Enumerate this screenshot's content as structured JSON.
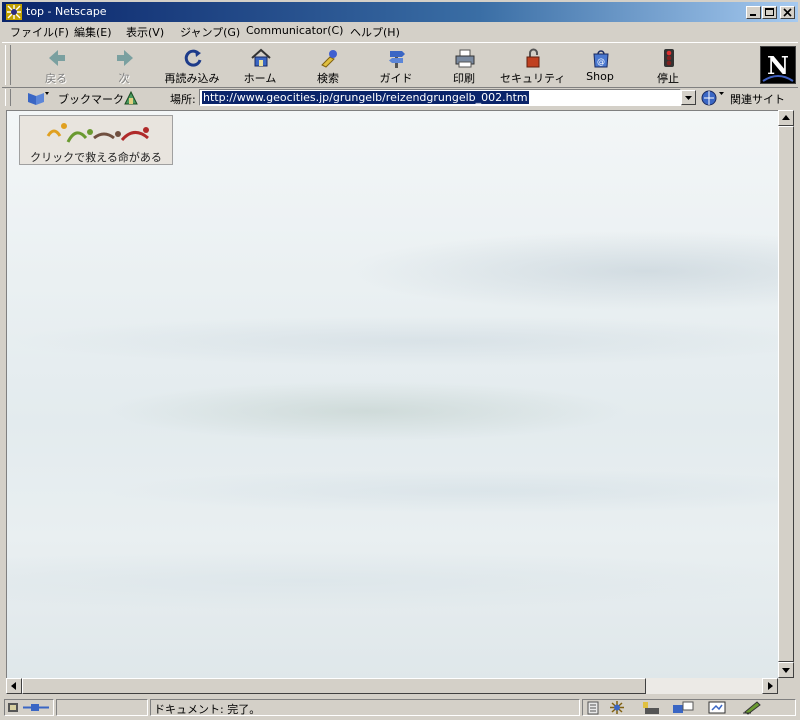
{
  "window": {
    "title": "top - Netscape"
  },
  "menu": [
    "ファイル(F)",
    "編集(E)",
    "表示(V)",
    "ジャンプ(G)",
    "Communicator(C)",
    "ヘルプ(H)"
  ],
  "toolbar": {
    "back": "戻る",
    "forward": "次",
    "reload": "再読み込み",
    "home": "ホーム",
    "search": "検索",
    "guide": "ガイド",
    "print": "印刷",
    "security": "セキュリティ",
    "shop": "Shop",
    "stop": "停止"
  },
  "location": {
    "bookmarks_label": "ブックマーク",
    "location_label": "場所:",
    "url": "http://www.geocities.jp/grungelb/reizendgrungelb_002.htm",
    "related_label": "関連サイト"
  },
  "content": {
    "banner_caption": "クリックで救える命がある"
  },
  "status": {
    "text": "ドキュメント: 完了。"
  }
}
